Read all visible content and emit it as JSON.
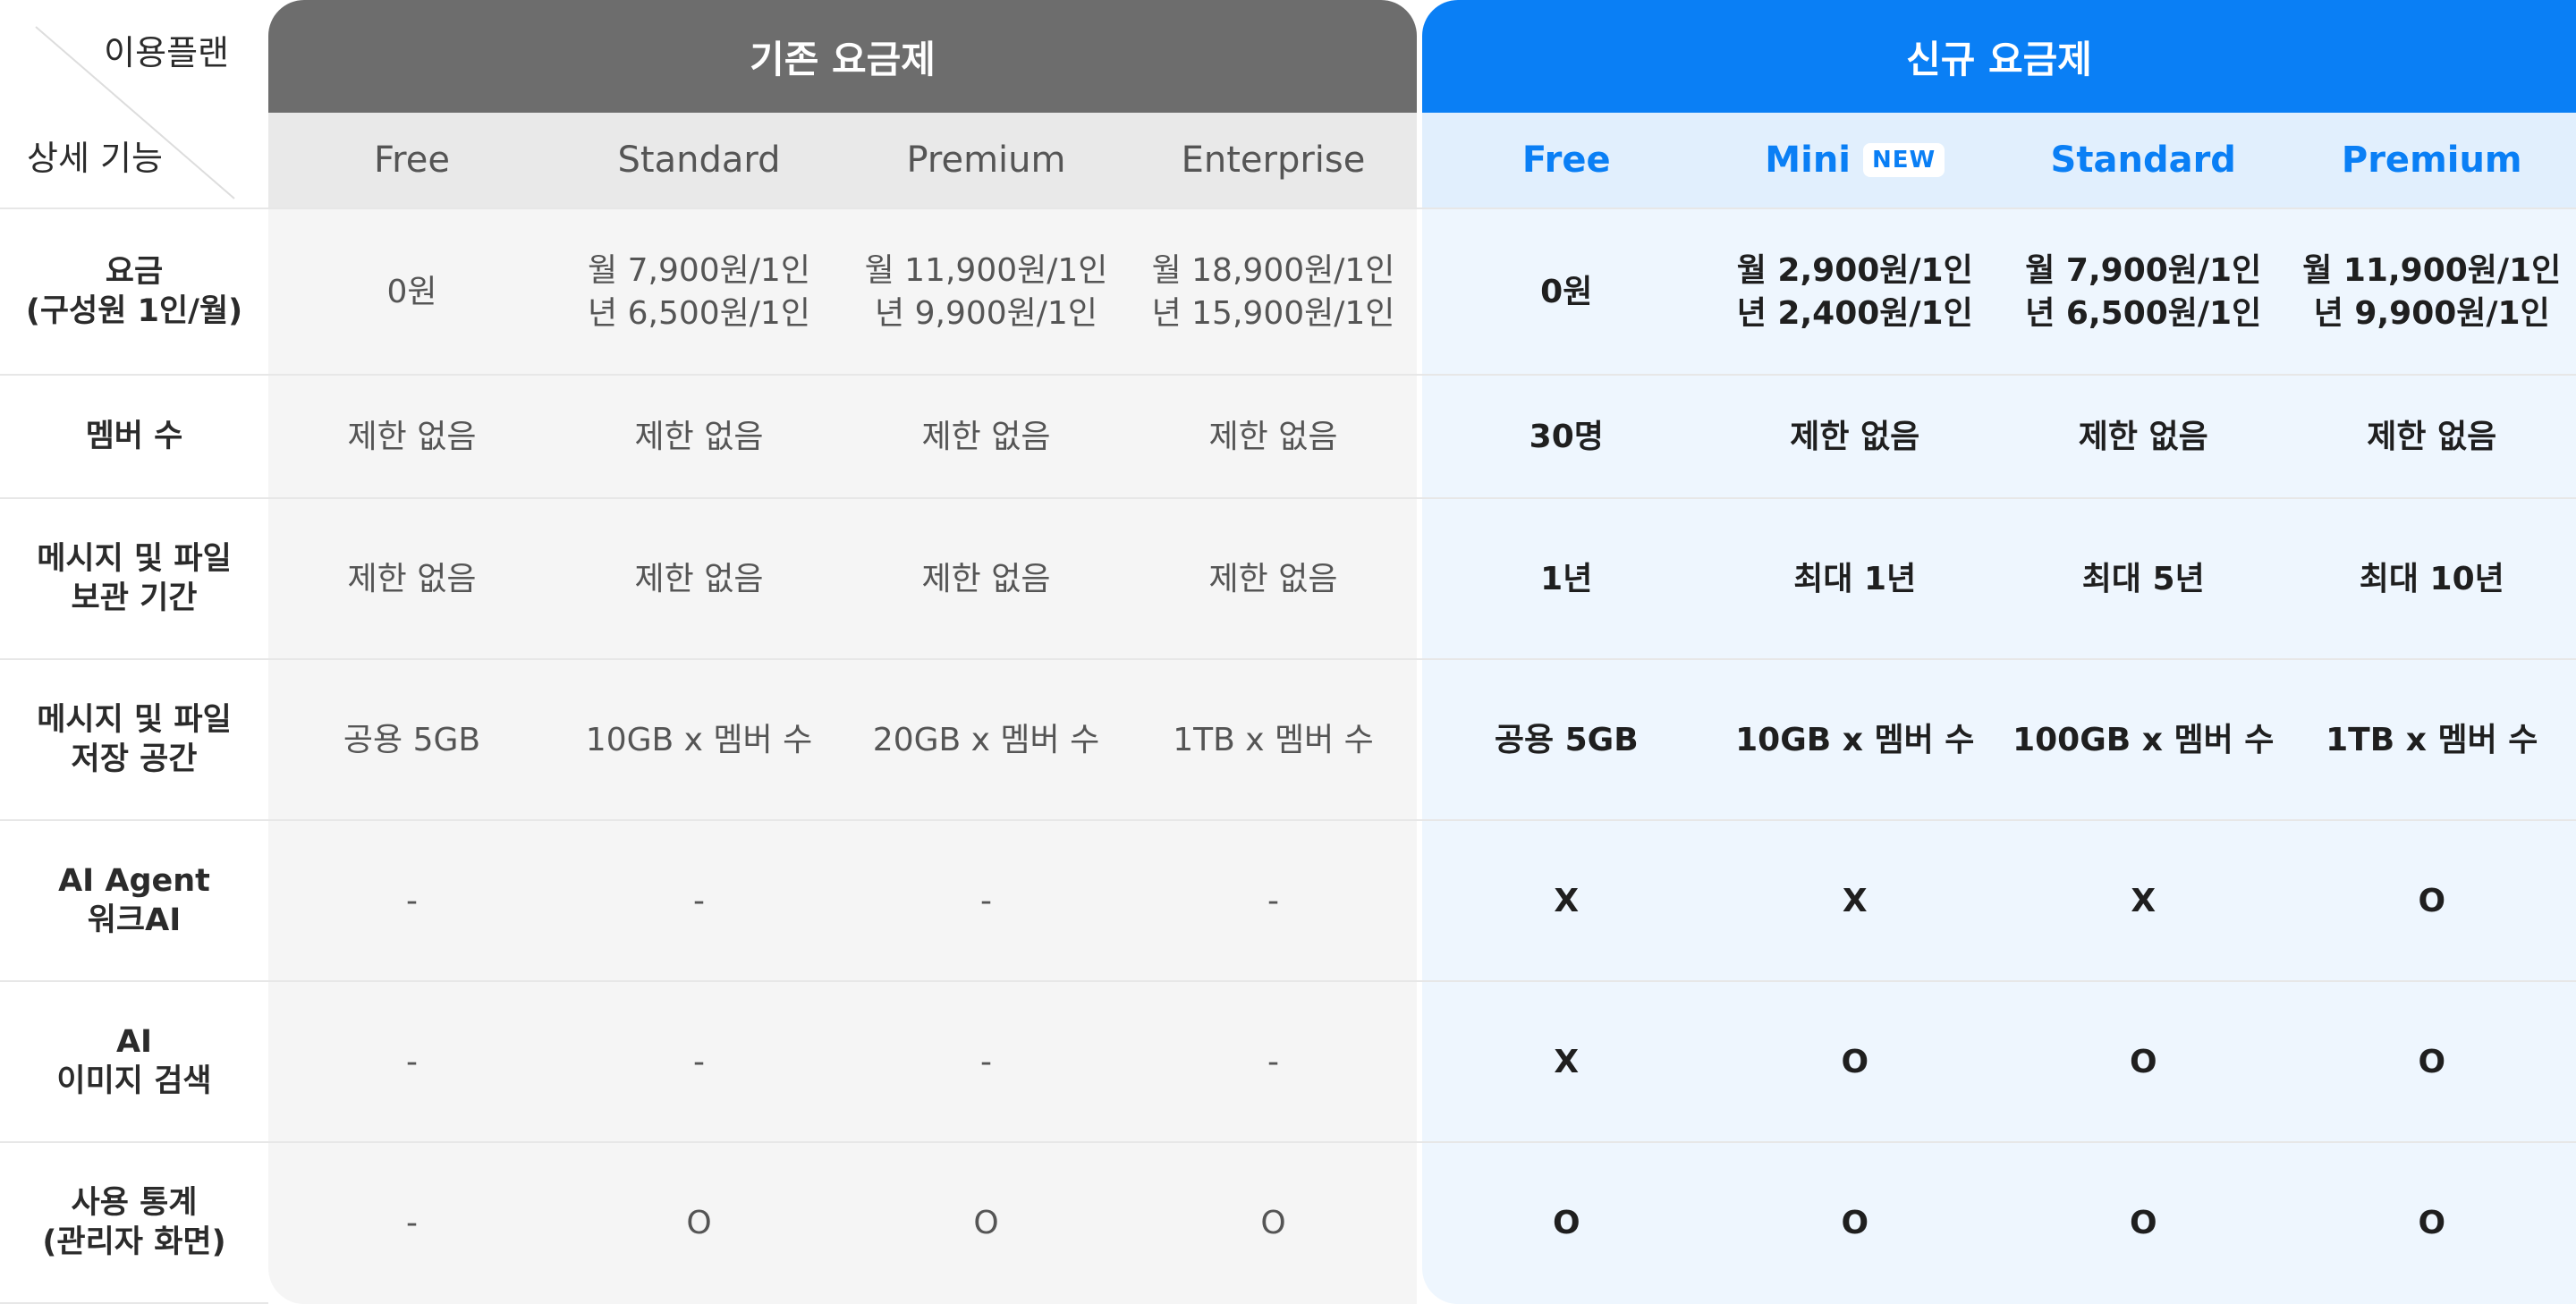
{
  "corner": {
    "top_label": "이용플랜",
    "bottom_label": "상세 기능"
  },
  "old_group": {
    "title": "기존 요금제",
    "plans": [
      "Free",
      "Standard",
      "Premium",
      "Enterprise"
    ]
  },
  "new_group": {
    "title": "신규 요금제",
    "plans": [
      "Free",
      "Mini",
      "Standard",
      "Premium"
    ],
    "new_badge": "NEW"
  },
  "rows": [
    {
      "label": [
        "요금",
        "(구성원 1인/월)"
      ],
      "old": [
        [
          "0원"
        ],
        [
          "월 7,900원/1인",
          "년 6,500원/1인"
        ],
        [
          "월 11,900원/1인",
          "년 9,900원/1인"
        ],
        [
          "월 18,900원/1인",
          "년 15,900원/1인"
        ]
      ],
      "new": [
        [
          "0원"
        ],
        [
          "월 2,900원/1인",
          "년 2,400원/1인"
        ],
        [
          "월 7,900원/1인",
          "년 6,500원/1인"
        ],
        [
          "월 11,900원/1인",
          "년 9,900원/1인"
        ]
      ]
    },
    {
      "label": [
        "멤버 수"
      ],
      "old": [
        [
          "제한 없음"
        ],
        [
          "제한 없음"
        ],
        [
          "제한 없음"
        ],
        [
          "제한 없음"
        ]
      ],
      "new": [
        [
          "30명"
        ],
        [
          "제한 없음"
        ],
        [
          "제한 없음"
        ],
        [
          "제한 없음"
        ]
      ]
    },
    {
      "label": [
        "메시지 및 파일",
        "보관 기간"
      ],
      "old": [
        [
          "제한 없음"
        ],
        [
          "제한 없음"
        ],
        [
          "제한 없음"
        ],
        [
          "제한 없음"
        ]
      ],
      "new": [
        [
          "1년"
        ],
        [
          "최대 1년"
        ],
        [
          "최대 5년"
        ],
        [
          "최대 10년"
        ]
      ]
    },
    {
      "label": [
        "메시지 및 파일",
        "저장 공간"
      ],
      "old": [
        [
          "공용 5GB"
        ],
        [
          "10GB x 멤버 수"
        ],
        [
          "20GB x 멤버 수"
        ],
        [
          "1TB x 멤버 수"
        ]
      ],
      "new": [
        [
          "공용 5GB"
        ],
        [
          "10GB x 멤버 수"
        ],
        [
          "100GB x 멤버 수"
        ],
        [
          "1TB x 멤버 수"
        ]
      ]
    },
    {
      "label": [
        "AI Agent",
        "워크AI"
      ],
      "old": [
        [
          "-"
        ],
        [
          "-"
        ],
        [
          "-"
        ],
        [
          "-"
        ]
      ],
      "new": [
        [
          "X"
        ],
        [
          "X"
        ],
        [
          "X"
        ],
        [
          "O"
        ]
      ]
    },
    {
      "label": [
        "AI",
        "이미지 검색"
      ],
      "old": [
        [
          "-"
        ],
        [
          "-"
        ],
        [
          "-"
        ],
        [
          "-"
        ]
      ],
      "new": [
        [
          "X"
        ],
        [
          "O"
        ],
        [
          "O"
        ],
        [
          "O"
        ]
      ]
    },
    {
      "label": [
        "사용 통계",
        "(관리자 화면)"
      ],
      "old": [
        [
          "-"
        ],
        [
          "O"
        ],
        [
          "O"
        ],
        [
          "O"
        ]
      ],
      "new": [
        [
          "O"
        ],
        [
          "O"
        ],
        [
          "O"
        ],
        [
          "O"
        ]
      ]
    }
  ],
  "colors": {
    "old_header": "#6d6d6d",
    "new_header": "#0a7ff5",
    "old_bg": "#f5f5f5",
    "new_bg": "#eef6fe"
  }
}
